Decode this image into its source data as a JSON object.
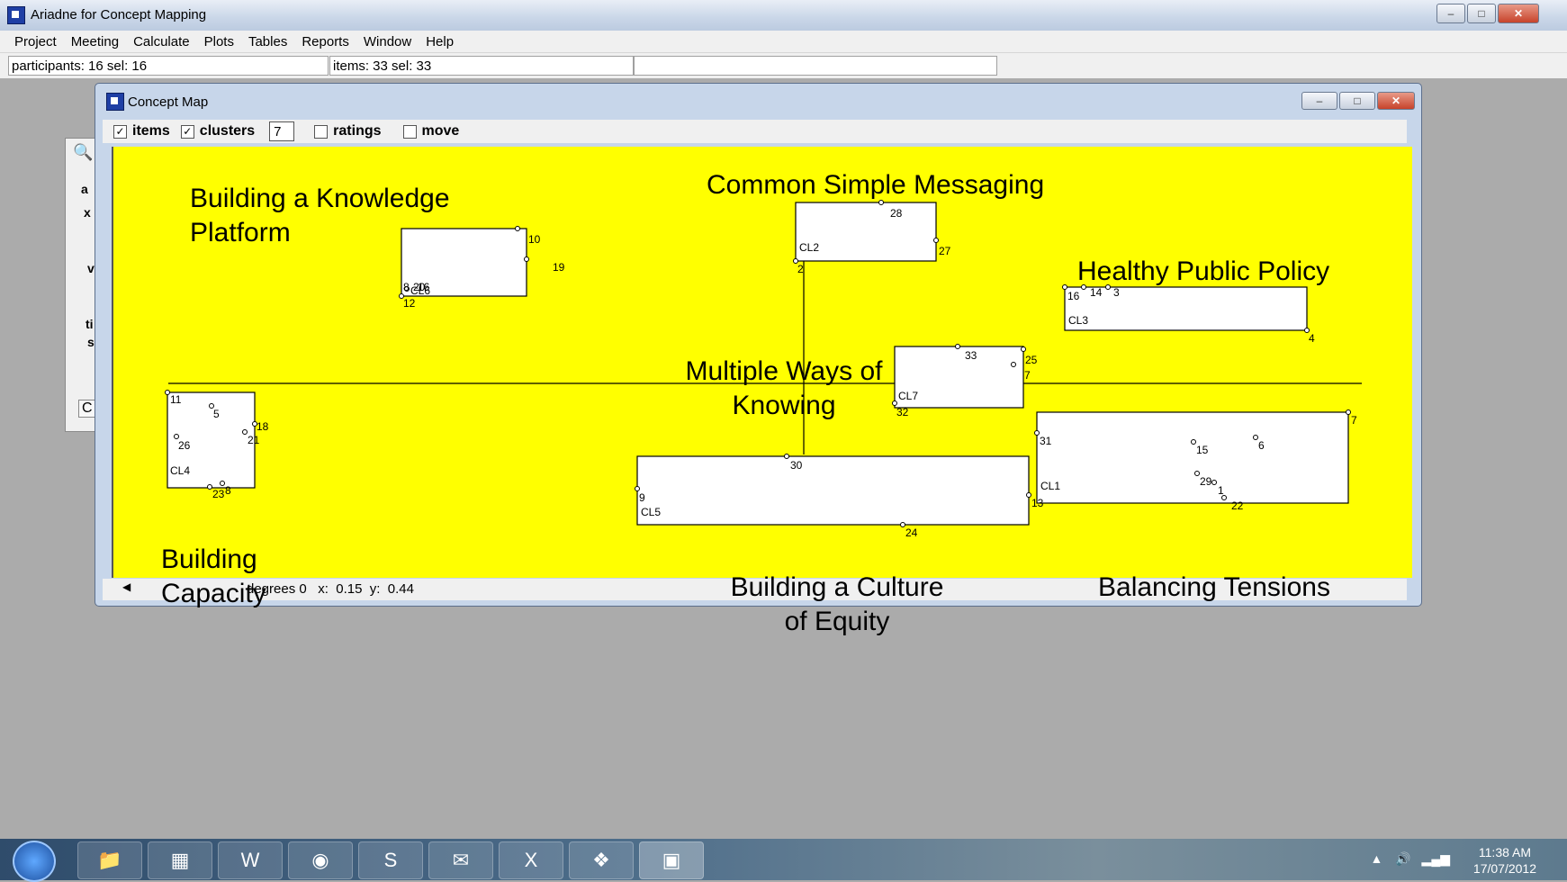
{
  "app": {
    "title": "Ariadne for Concept Mapping"
  },
  "menu": [
    "Project",
    "Meeting",
    "Calculate",
    "Plots",
    "Tables",
    "Reports",
    "Window",
    "Help"
  ],
  "status": {
    "participants": "participants: 16 sel: 16",
    "items": "items: 33 sel: 33"
  },
  "concept_map": {
    "title": "Concept Map",
    "toolbar": {
      "items_label": "items",
      "items_checked": true,
      "clusters_label": "clusters",
      "clusters_checked": true,
      "cluster_count": "7",
      "ratings_label": "ratings",
      "ratings_checked": false,
      "move_label": "move",
      "move_checked": false
    },
    "bottom_status": "degrees 0   x:  0.15  y:  0.44",
    "cluster_labels": {
      "knowledge_platform_1": "Building a Knowledge",
      "knowledge_platform_2": "Platform",
      "common_messaging": "Common Simple Messaging",
      "healthy_policy": "Healthy Public Policy",
      "multiple_ways_1": "Multiple Ways of",
      "multiple_ways_2": "Knowing",
      "building_capacity_1": "Building",
      "building_capacity_2": "Capacity",
      "culture_equity_1": "Building a Culture",
      "culture_equity_2": "of Equity",
      "balancing_tensions": "Balancing Tensions"
    },
    "clusters": [
      "CL1",
      "CL2",
      "CL3",
      "CL4",
      "CL5",
      "CL6",
      "CL7"
    ],
    "items": [
      "1",
      "2",
      "3",
      "4",
      "5",
      "6",
      "7",
      "8",
      "9",
      "10",
      "11",
      "12",
      "13",
      "14",
      "15",
      "16",
      "17",
      "18",
      "19",
      "20",
      "21",
      "22",
      "23",
      "24",
      "25",
      "26",
      "27",
      "28",
      "29",
      "30",
      "31",
      "32",
      "33"
    ]
  },
  "background_dialog": {
    "letters": [
      "a",
      "x",
      "v",
      "ti",
      "s",
      "C"
    ]
  },
  "taskbar": {
    "time": "11:38 AM",
    "date": "17/07/2012"
  }
}
